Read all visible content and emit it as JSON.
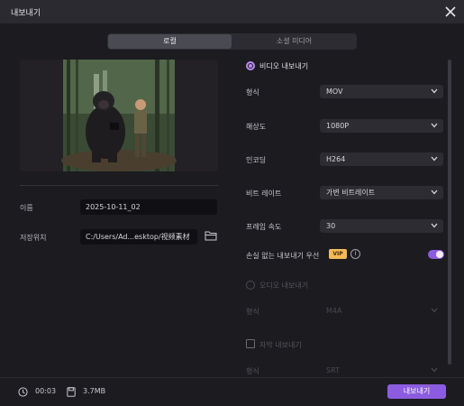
{
  "window": {
    "title": "내보내기"
  },
  "tabs": [
    {
      "label": "로컬",
      "active": true
    },
    {
      "label": "소셜 미디어",
      "active": false
    }
  ],
  "left": {
    "name_label": "이름",
    "name_value": "2025-10-11_02",
    "location_label": "저장위치",
    "location_value": "C:/Users/Ad...esktop/视频素材"
  },
  "right": {
    "video_export": "비디오 내보내기",
    "fields": [
      {
        "label": "형식",
        "value": "MOV"
      },
      {
        "label": "해상도",
        "value": "1080P"
      },
      {
        "label": "인코딩",
        "value": "H264"
      },
      {
        "label": "비트 레이트",
        "value": "가변 비트레이트"
      },
      {
        "label": "프레임 속도",
        "value": "30"
      }
    ],
    "lossless_label": "손실 없는 내보내기 우선",
    "vip_badge": "VIP",
    "info_glyph": "i",
    "lossless_enabled": true,
    "audio_export": "오디오 내보내기",
    "audio_format_label": "형식",
    "audio_format_value": "M4A",
    "subtitle_export": "자막 내보내기",
    "subtitle_format_label": "형식",
    "subtitle_format_value": "SRT"
  },
  "footer": {
    "duration": "00:03",
    "size": "3.7MB",
    "export_button": "내보내기"
  },
  "colors": {
    "accent": "#8c5ce0",
    "radio": "#b88cf2",
    "vip": "#f7b955",
    "background": "#1b1b20"
  },
  "icons": [
    "close-icon",
    "folder-icon",
    "chevron-down-icon",
    "clock-icon",
    "file-size-icon",
    "info-icon"
  ]
}
